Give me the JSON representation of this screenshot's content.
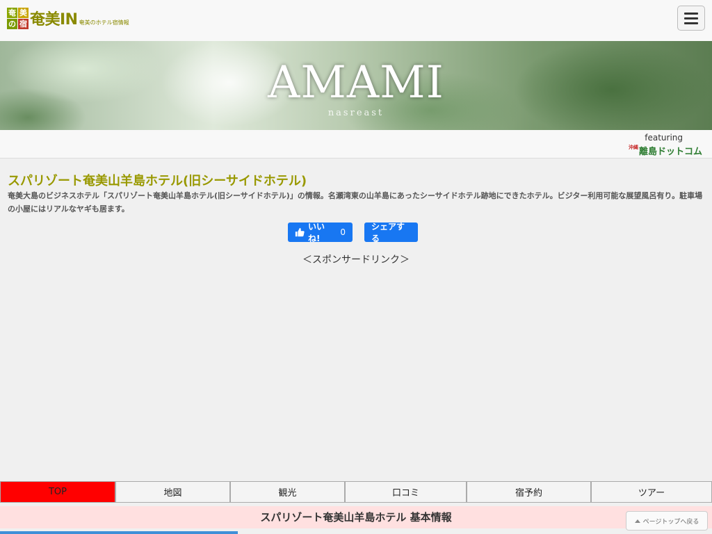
{
  "header": {
    "logo_chars": [
      "奄",
      "美",
      "の",
      "宿"
    ],
    "logo_title": "奄美IN",
    "logo_sub": "奄美のホテル宿情報"
  },
  "hero": {
    "title": "AMAMI",
    "subtitle": "nasreast"
  },
  "feature": {
    "label": "featuring",
    "logo_small": "沖縄",
    "logo_text": "離島ドットコム"
  },
  "main": {
    "title": "スパリゾート奄美山羊島ホテル(旧シーサイドホテル)",
    "description": "奄美大島のビジネスホテル「スパリゾート奄美山羊島ホテル(旧シーサイドホテル)」の情報。名瀬湾東の山羊島にあったシーサイドホテル跡地にできたホテル。ビジター利用可能な展望風呂有り。駐車場の小屋にはリアルなヤギも居ます。",
    "like_label": "いいね!",
    "like_count": "0",
    "share_label": "シェアする",
    "sponsor_label": "＜スポンサードリンク＞"
  },
  "tabs": [
    {
      "label": "TOP",
      "active": true
    },
    {
      "label": "地図",
      "active": false
    },
    {
      "label": "観光",
      "active": false
    },
    {
      "label": "口コミ",
      "active": false
    },
    {
      "label": "宿予約",
      "active": false
    },
    {
      "label": "ツアー",
      "active": false
    }
  ],
  "info_header": "スパリゾート奄美山羊島ホテル 基本情報",
  "pagetop_label": "ページトップへ戻る",
  "colors": {
    "title": "#999900",
    "facebook": "#1877f2",
    "active_tab": "#ff0000",
    "info_header_bg": "#ffe0e0"
  }
}
